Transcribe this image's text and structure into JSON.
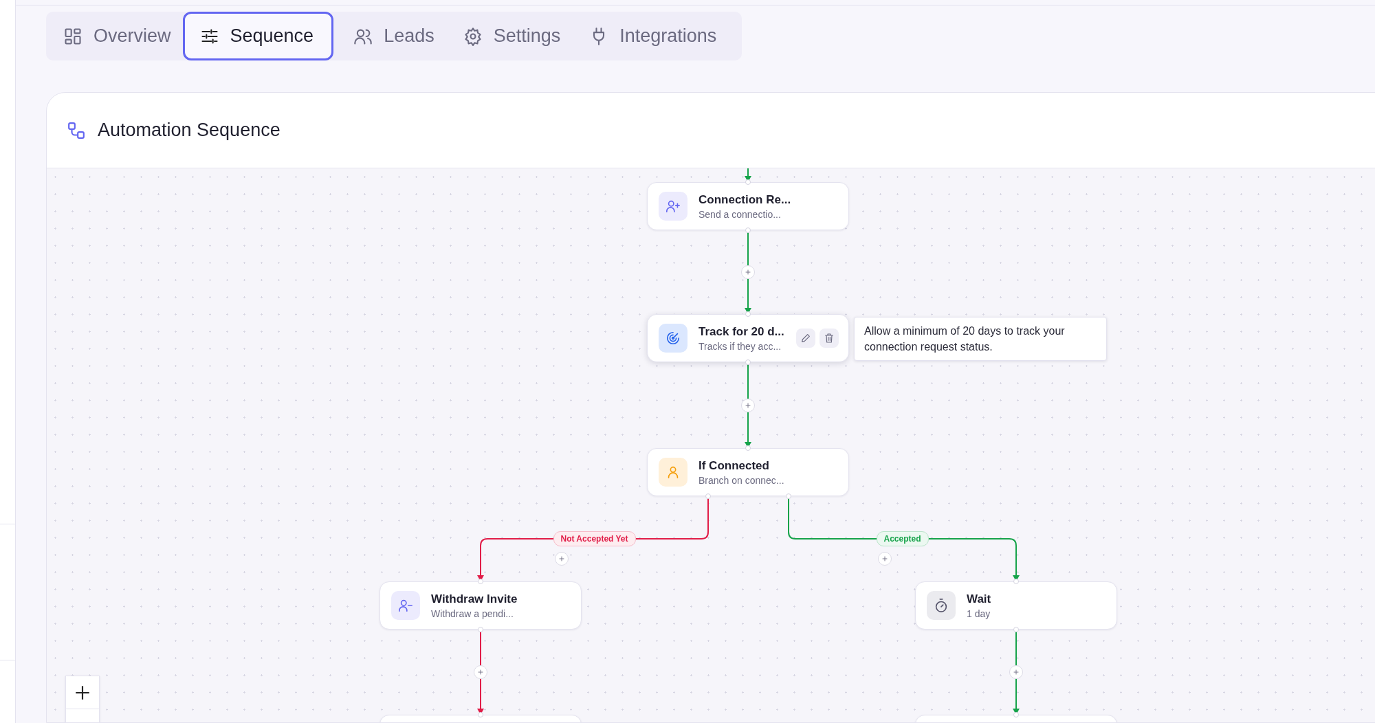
{
  "tabs": [
    {
      "label": "Overview",
      "selected": false
    },
    {
      "label": "Sequence",
      "selected": true
    },
    {
      "label": "Leads",
      "selected": false
    },
    {
      "label": "Settings",
      "selected": false
    },
    {
      "label": "Integrations",
      "selected": false
    }
  ],
  "card": {
    "title": "Automation Sequence"
  },
  "nodes": [
    {
      "kind": "connect",
      "title": "Connection Re...",
      "subtitle": "Send a connectio...",
      "hovered": false
    },
    {
      "kind": "track",
      "title": "Track for 20 d...",
      "subtitle": "Tracks if they acc...",
      "hovered": true,
      "tooltip": "Allow a minimum of 20 days to track your connection request status."
    },
    {
      "kind": "condition",
      "title": "If Connected",
      "subtitle": "Branch on connec...",
      "hovered": false
    },
    {
      "kind": "withdraw",
      "title": "Withdraw Invite",
      "subtitle": "Withdraw a pendi...",
      "hovered": false
    },
    {
      "kind": "wait",
      "title": "Wait",
      "subtitle": "1 day",
      "hovered": false
    },
    {
      "kind": "cut"
    },
    {
      "kind": "cut"
    }
  ],
  "edges": [
    {
      "kind": "incoming",
      "color": "#16a34a"
    },
    {
      "kind": "step",
      "color": "#16a34a"
    },
    {
      "kind": "step",
      "color": "#16a34a"
    },
    {
      "kind": "branch",
      "color": "#e11d48",
      "label": "Not Accepted Yet"
    },
    {
      "kind": "branch",
      "color": "#16a34a",
      "label": "Accepted"
    },
    {
      "kind": "step",
      "color": "#e11d48"
    },
    {
      "kind": "step",
      "color": "#16a34a"
    }
  ]
}
